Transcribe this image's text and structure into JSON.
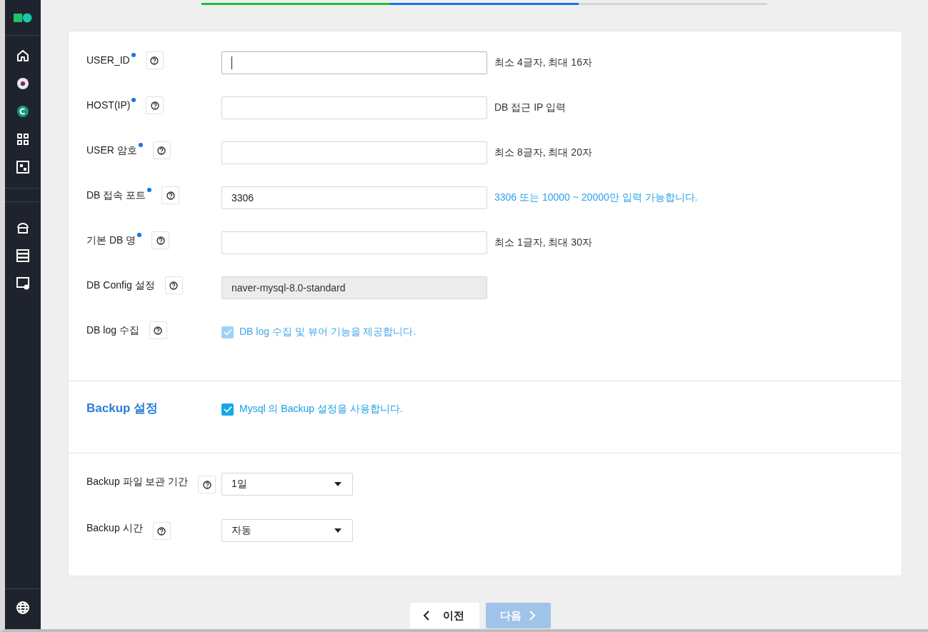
{
  "progress": [
    {
      "kind": "done"
    },
    {
      "kind": "current"
    },
    {
      "kind": "todo"
    }
  ],
  "fields": [
    {
      "kind": "text",
      "label": "USER_ID",
      "required": true,
      "focused": true,
      "hint": "최소 4글자, 최대 16자",
      "hint_highlighted": false
    },
    {
      "kind": "text",
      "label": "HOST(IP)",
      "required": true,
      "focused": false,
      "hint": "DB 접근 IP 입력",
      "hint_highlighted": false
    },
    {
      "kind": "text",
      "label": "USER 암호",
      "required": true,
      "focused": false,
      "hint": "최소 8글자, 최대 20자",
      "hint_highlighted": false
    },
    {
      "kind": "text",
      "label": "DB 접속 포트",
      "required": true,
      "value": "3306",
      "focused": false,
      "hint": "3306 또는 10000 ~ 20000만 입력 가능합니다.",
      "hint_highlighted": true
    },
    {
      "kind": "text",
      "label": "기본 DB 명",
      "required": true,
      "focused": false,
      "hint": "최소 1글자, 최대 30자",
      "hint_highlighted": false
    },
    {
      "kind": "readonly",
      "label": "DB Config 설정",
      "required": false,
      "value": "naver-mysql-8.0-standard"
    },
    {
      "kind": "checkbox",
      "label": "DB log 수집",
      "required": false,
      "checked": true,
      "disabled": true,
      "text": "DB log 수집 및 뷰어 기능을 제공합니다."
    }
  ],
  "backup": {
    "title": "Backup 설정",
    "checked": true,
    "disabled": false,
    "text": "Mysql 의 Backup 설정을 사용합니다."
  },
  "backup_fields": [
    {
      "label": "Backup 파일 보관 기간",
      "value": "1일"
    },
    {
      "label": "Backup 시간",
      "value": "자동"
    }
  ],
  "buttons": {
    "prev": "이전",
    "next": "다음",
    "next_disabled": true
  }
}
